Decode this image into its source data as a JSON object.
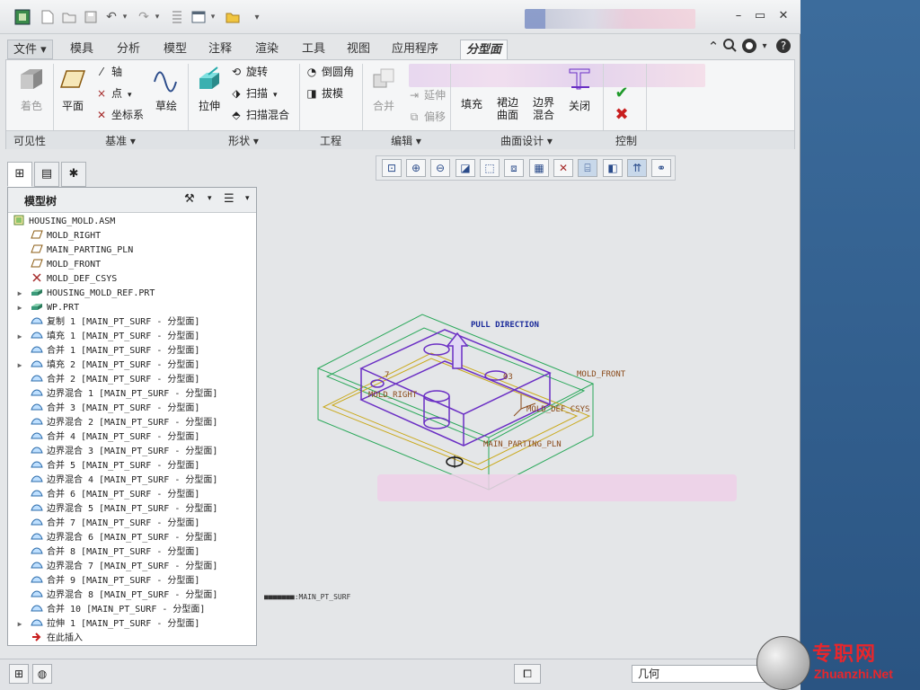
{
  "title_bar": {
    "qat_icons": [
      "app-icon",
      "new-icon",
      "open-icon",
      "save-icon",
      "undo-icon",
      "redo-icon",
      "regenerate-icon",
      "windows-icon",
      "folder-icon",
      "customize-icon"
    ],
    "window_buttons": [
      "minimize",
      "restore",
      "close"
    ]
  },
  "tabs": [
    {
      "label": "文件 ▾"
    },
    {
      "label": "模具"
    },
    {
      "label": "分析"
    },
    {
      "label": "模型"
    },
    {
      "label": "注释"
    },
    {
      "label": "渲染"
    },
    {
      "label": "工具"
    },
    {
      "label": "视图"
    },
    {
      "label": "应用程序"
    },
    {
      "label": "分型面"
    }
  ],
  "ribbon": {
    "visibility": {
      "shade": "着色",
      "group": "可见性"
    },
    "datum": {
      "plane": "平面",
      "axis": "轴",
      "point": "点",
      "csys": "坐标系",
      "sketch": "草绘",
      "group": "基准"
    },
    "shape": {
      "extrude": "拉伸",
      "revolve": "旋转",
      "sweep": "扫描",
      "swept_blend": "扫描混合",
      "group": "形状"
    },
    "engineering": {
      "round": "倒圆角",
      "draft": "拔模",
      "group": "工程"
    },
    "editing": {
      "merge": "合并",
      "extend": "延伸",
      "offset": "偏移",
      "group": "编辑"
    },
    "surface_design": {
      "fill": "填充",
      "skirt_line1": "裙边",
      "skirt_line2": "曲面",
      "bblend_line1": "边界",
      "bblend_line2": "混合",
      "close": "关闭",
      "group": "曲面设计"
    },
    "control": {
      "group": "控制"
    }
  },
  "panel": {
    "title": "模型树",
    "items": [
      {
        "label": "HOUSING_MOLD.ASM",
        "icon": "assembly-icon",
        "level": 0,
        "expand": ""
      },
      {
        "label": "MOLD_RIGHT",
        "icon": "datum-plane-icon",
        "level": 1,
        "expand": ""
      },
      {
        "label": "MAIN_PARTING_PLN",
        "icon": "datum-plane-icon",
        "level": 1,
        "expand": ""
      },
      {
        "label": "MOLD_FRONT",
        "icon": "datum-plane-icon",
        "level": 1,
        "expand": ""
      },
      {
        "label": "MOLD_DEF_CSYS",
        "icon": "csys-icon",
        "level": 1,
        "expand": ""
      },
      {
        "label": "HOUSING_MOLD_REF.PRT",
        "icon": "part-icon",
        "level": 1,
        "expand": "▶"
      },
      {
        "label": "WP.PRT",
        "icon": "part-icon",
        "level": 1,
        "expand": "▶"
      },
      {
        "label": "复制 1 [MAIN_PT_SURF - 分型面]",
        "icon": "surface-icon",
        "level": 1,
        "expand": ""
      },
      {
        "label": "填充 1 [MAIN_PT_SURF - 分型面]",
        "icon": "surface-icon",
        "level": 1,
        "expand": "▶"
      },
      {
        "label": "合并 1 [MAIN_PT_SURF - 分型面]",
        "icon": "surface-icon",
        "level": 1,
        "expand": ""
      },
      {
        "label": "填充 2 [MAIN_PT_SURF - 分型面]",
        "icon": "surface-icon",
        "level": 1,
        "expand": "▶"
      },
      {
        "label": "合并 2 [MAIN_PT_SURF - 分型面]",
        "icon": "surface-icon",
        "level": 1,
        "expand": ""
      },
      {
        "label": "边界混合 1 [MAIN_PT_SURF - 分型面]",
        "icon": "surface-icon",
        "level": 1,
        "expand": ""
      },
      {
        "label": "合并 3 [MAIN_PT_SURF - 分型面]",
        "icon": "surface-icon",
        "level": 1,
        "expand": ""
      },
      {
        "label": "边界混合 2 [MAIN_PT_SURF - 分型面]",
        "icon": "surface-icon",
        "level": 1,
        "expand": ""
      },
      {
        "label": "合并 4 [MAIN_PT_SURF - 分型面]",
        "icon": "surface-icon",
        "level": 1,
        "expand": ""
      },
      {
        "label": "边界混合 3 [MAIN_PT_SURF - 分型面]",
        "icon": "surface-icon",
        "level": 1,
        "expand": ""
      },
      {
        "label": "合并 5 [MAIN_PT_SURF - 分型面]",
        "icon": "surface-icon",
        "level": 1,
        "expand": ""
      },
      {
        "label": "边界混合 4 [MAIN_PT_SURF - 分型面]",
        "icon": "surface-icon",
        "level": 1,
        "expand": ""
      },
      {
        "label": "合并 6 [MAIN_PT_SURF - 分型面]",
        "icon": "surface-icon",
        "level": 1,
        "expand": ""
      },
      {
        "label": "边界混合 5 [MAIN_PT_SURF - 分型面]",
        "icon": "surface-icon",
        "level": 1,
        "expand": ""
      },
      {
        "label": "合并 7 [MAIN_PT_SURF - 分型面]",
        "icon": "surface-icon",
        "level": 1,
        "expand": ""
      },
      {
        "label": "边界混合 6 [MAIN_PT_SURF - 分型面]",
        "icon": "surface-icon",
        "level": 1,
        "expand": ""
      },
      {
        "label": "合并 8 [MAIN_PT_SURF - 分型面]",
        "icon": "surface-icon",
        "level": 1,
        "expand": ""
      },
      {
        "label": "边界混合 7 [MAIN_PT_SURF - 分型面]",
        "icon": "surface-icon",
        "level": 1,
        "expand": ""
      },
      {
        "label": "合并 9 [MAIN_PT_SURF - 分型面]",
        "icon": "surface-icon",
        "level": 1,
        "expand": ""
      },
      {
        "label": "边界混合 8 [MAIN_PT_SURF - 分型面]",
        "icon": "surface-icon",
        "level": 1,
        "expand": ""
      },
      {
        "label": "合并 10 [MAIN_PT_SURF - 分型面]",
        "icon": "surface-icon",
        "level": 1,
        "expand": ""
      },
      {
        "label": "拉伸 1 [MAIN_PT_SURF - 分型面]",
        "icon": "surface-icon",
        "level": 1,
        "expand": "▶"
      },
      {
        "label": "在此插入",
        "icon": "insert-arrow-icon",
        "level": 1,
        "expand": ""
      }
    ]
  },
  "viewport": {
    "labels": {
      "pull_direction": "PULL DIRECTION",
      "mold_front": "MOLD_FRONT",
      "mold_right": "MOLD_RIGHT",
      "mold_def_csys": "MOLD_DEF_CSYS",
      "main_parting_pln": "MAIN_PARTING_PLN",
      "mold_right_partial": "7",
      "csys_partial": "03"
    },
    "status_text": "■■■■■■■:MAIN_PT_SURF"
  },
  "statusbar": {
    "filter_value": "几何"
  },
  "watermark": {
    "cn": "专职网",
    "en": "Zhuanzhi.Net"
  },
  "colors": {
    "accent_blue": "#2a4b8a",
    "wire_green": "#2aa85a",
    "wire_yellow": "#c9a818",
    "wire_purple": "#6a2ec4",
    "label_brown": "#8a4a1a",
    "label_blue": "#1a2a9a"
  }
}
